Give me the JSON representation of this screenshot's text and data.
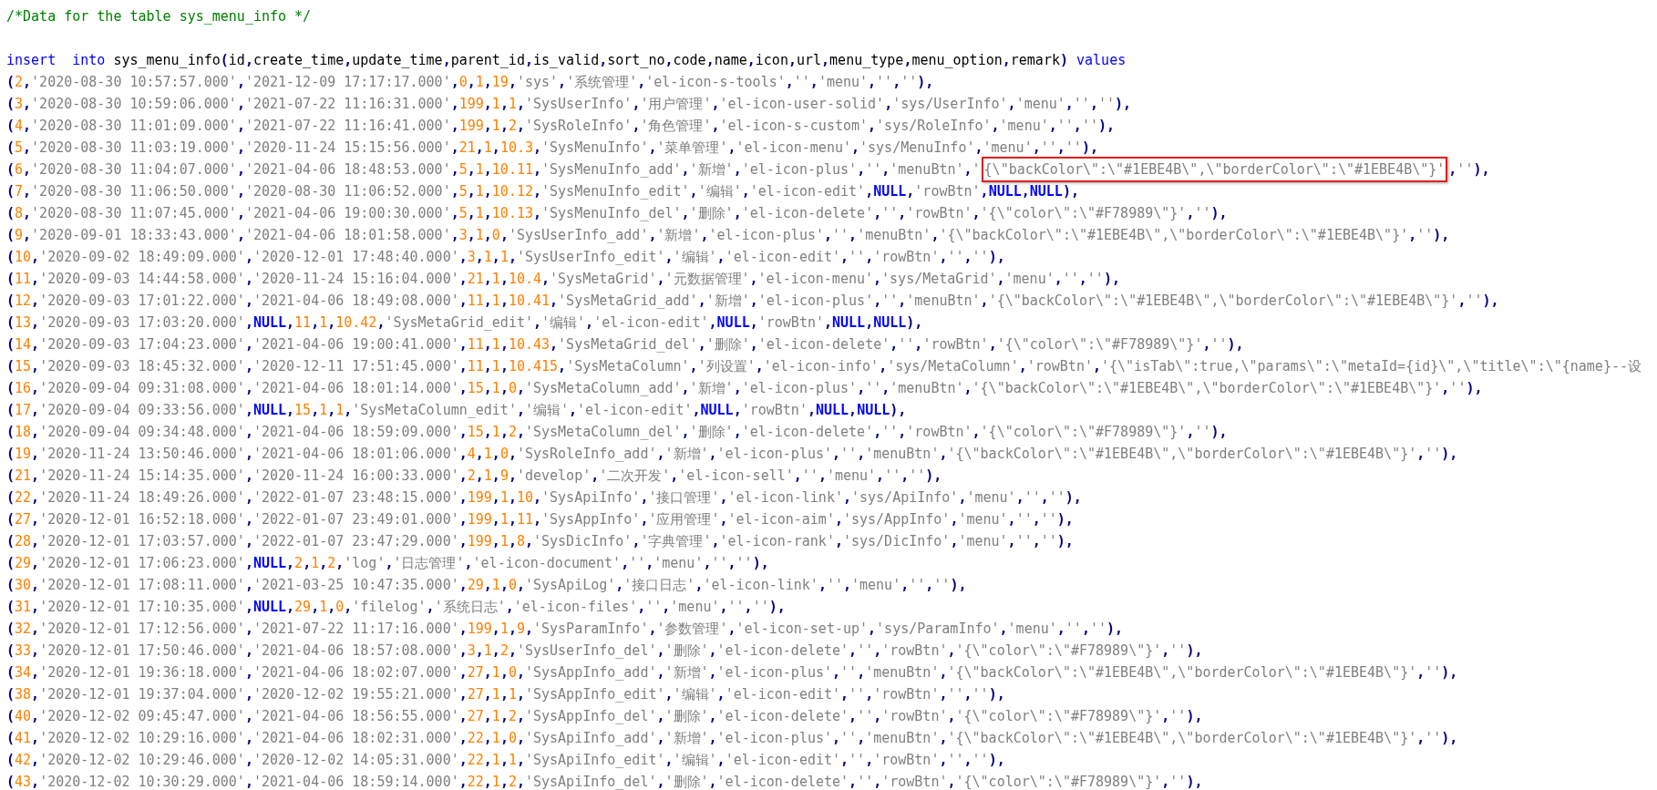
{
  "editor": {
    "lines": [
      {
        "kind": "comment",
        "text": "/*Data for the table sys_menu_info */"
      },
      {
        "kind": "blank"
      },
      {
        "kind": "statement",
        "segments": [
          {
            "kind": "keyword",
            "text": "insert"
          },
          {
            "kind": "keyword",
            "text": "into"
          },
          {
            "kind": "identifier",
            "text": "sys_menu_info(id,create_time,update_time,parent_id,is_valid,sort_no,code,name,icon,url,menu_type,menu_option,remark)"
          },
          {
            "kind": "keyword",
            "text": "values"
          }
        ]
      },
      {
        "kind": "row",
        "text": "(2,'2020-08-30 10:57:57.000','2021-12-09 17:17:17.000',0,1,19,'sys','系统管理','el-icon-s-tools','','menu','',''),"
      },
      {
        "kind": "row",
        "text": "(3,'2020-08-30 10:59:06.000','2021-07-22 11:16:31.000',199,1,1,'SysUserInfo','用户管理','el-icon-user-solid','sys/UserInfo','menu','',''),"
      },
      {
        "kind": "row",
        "text": "(4,'2020-08-30 11:01:09.000','2021-07-22 11:16:41.000',199,1,2,'SysRoleInfo','角色管理','el-icon-s-custom','sys/RoleInfo','menu','',''),"
      },
      {
        "kind": "row",
        "text": "(5,'2020-08-30 11:03:19.000','2020-11-24 15:15:56.000',21,1,10.3,'SysMenuInfo','菜单管理','el-icon-menu','sys/MenuInfo','menu','',''),"
      },
      {
        "kind": "row",
        "segments": [
          {
            "text": "(6,'2020-08-30 11:04:07.000','2021-04-06 18:48:53.000',5,1,10.11,'SysMenuInfo_add','新增','el-icon-plus','','menuBtn','",
            "highlighted": false
          },
          {
            "text": "{\\\"backColor\\\":\\\"#1EBE4B\\\",\\\"borderColor\\\":\\\"#1EBE4B\\\"}'",
            "highlighted": true
          },
          {
            "text": ",''),",
            "highlighted": false
          }
        ]
      },
      {
        "kind": "row",
        "text": "(7,'2020-08-30 11:06:50.000','2020-08-30 11:06:52.000',5,1,10.12,'SysMenuInfo_edit','编辑','el-icon-edit',NULL,'rowBtn',NULL,NULL),"
      },
      {
        "kind": "row",
        "text": "(8,'2020-08-30 11:07:45.000','2021-04-06 19:00:30.000',5,1,10.13,'SysMenuInfo_del','删除','el-icon-delete','','rowBtn','{\\\"color\\\":\\\"#F78989\\\"}',''),"
      },
      {
        "kind": "row",
        "text": "(9,'2020-09-01 18:33:43.000','2021-04-06 18:01:58.000',3,1,0,'SysUserInfo_add','新增','el-icon-plus','','menuBtn','{\\\"backColor\\\":\\\"#1EBE4B\\\",\\\"borderColor\\\":\\\"#1EBE4B\\\"}',''),"
      },
      {
        "kind": "row",
        "text": "(10,'2020-09-02 18:49:09.000','2020-12-01 17:48:40.000',3,1,1,'SysUserInfo_edit','编辑','el-icon-edit','','rowBtn','',''),"
      },
      {
        "kind": "row",
        "text": "(11,'2020-09-03 14:44:58.000','2020-11-24 15:16:04.000',21,1,10.4,'SysMetaGrid','元数据管理','el-icon-menu','sys/MetaGrid','menu','',''),"
      },
      {
        "kind": "row",
        "text": "(12,'2020-09-03 17:01:22.000','2021-04-06 18:49:08.000',11,1,10.41,'SysMetaGrid_add','新增','el-icon-plus','','menuBtn','{\\\"backColor\\\":\\\"#1EBE4B\\\",\\\"borderColor\\\":\\\"#1EBE4B\\\"}',''),"
      },
      {
        "kind": "row",
        "text": "(13,'2020-09-03 17:03:20.000',NULL,11,1,10.42,'SysMetaGrid_edit','编辑','el-icon-edit',NULL,'rowBtn',NULL,NULL),"
      },
      {
        "kind": "row",
        "text": "(14,'2020-09-03 17:04:23.000','2021-04-06 19:00:41.000',11,1,10.43,'SysMetaGrid_del','删除','el-icon-delete','','rowBtn','{\\\"color\\\":\\\"#F78989\\\"}',''),"
      },
      {
        "kind": "row",
        "text": "(15,'2020-09-03 18:45:32.000','2020-12-11 17:51:45.000',11,1,10.415,'SysMetaColumn','列设置','el-icon-info','sys/MetaColumn','rowBtn','{\\\"isTab\\\":true,\\\"params\\\":\\\"metaId={id}\\\",\\\"title\\\":\\\"{name}--设"
      },
      {
        "kind": "row",
        "text": "(16,'2020-09-04 09:31:08.000','2021-04-06 18:01:14.000',15,1,0,'SysMetaColumn_add','新增','el-icon-plus','','menuBtn','{\\\"backColor\\\":\\\"#1EBE4B\\\",\\\"borderColor\\\":\\\"#1EBE4B\\\"}',''),"
      },
      {
        "kind": "row",
        "text": "(17,'2020-09-04 09:33:56.000',NULL,15,1,1,'SysMetaColumn_edit','编辑','el-icon-edit',NULL,'rowBtn',NULL,NULL),"
      },
      {
        "kind": "row",
        "text": "(18,'2020-09-04 09:34:48.000','2021-04-06 18:59:09.000',15,1,2,'SysMetaColumn_del','删除','el-icon-delete','','rowBtn','{\\\"color\\\":\\\"#F78989\\\"}',''),"
      },
      {
        "kind": "row",
        "text": "(19,'2020-11-24 13:50:46.000','2021-04-06 18:01:06.000',4,1,0,'SysRoleInfo_add','新增','el-icon-plus','','menuBtn','{\\\"backColor\\\":\\\"#1EBE4B\\\",\\\"borderColor\\\":\\\"#1EBE4B\\\"}',''),"
      },
      {
        "kind": "row",
        "text": "(21,'2020-11-24 15:14:35.000','2020-11-24 16:00:33.000',2,1,9,'develop','二次开发','el-icon-sell','','menu','',''),"
      },
      {
        "kind": "row",
        "text": "(22,'2020-11-24 18:49:26.000','2022-01-07 23:48:15.000',199,1,10,'SysApiInfo','接口管理','el-icon-link','sys/ApiInfo','menu','',''),"
      },
      {
        "kind": "row",
        "text": "(27,'2020-12-01 16:52:18.000','2022-01-07 23:49:01.000',199,1,11,'SysAppInfo','应用管理','el-icon-aim','sys/AppInfo','menu','',''),"
      },
      {
        "kind": "row",
        "text": "(28,'2020-12-01 17:03:57.000','2022-01-07 23:47:29.000',199,1,8,'SysDicInfo','字典管理','el-icon-rank','sys/DicInfo','menu','',''),"
      },
      {
        "kind": "row",
        "text": "(29,'2020-12-01 17:06:23.000',NULL,2,1,2,'log','日志管理','el-icon-document','','menu','',''),"
      },
      {
        "kind": "row",
        "text": "(30,'2020-12-01 17:08:11.000','2021-03-25 10:47:35.000',29,1,0,'SysApiLog','接口日志','el-icon-link','','menu','',''),"
      },
      {
        "kind": "row",
        "text": "(31,'2020-12-01 17:10:35.000',NULL,29,1,0,'filelog','系统日志','el-icon-files','','menu','',''),"
      },
      {
        "kind": "row",
        "text": "(32,'2020-12-01 17:12:56.000','2021-07-22 11:17:16.000',199,1,9,'SysParamInfo','参数管理','el-icon-set-up','sys/ParamInfo','menu','',''),"
      },
      {
        "kind": "row",
        "text": "(33,'2020-12-01 17:50:46.000','2021-04-06 18:57:08.000',3,1,2,'SysUserInfo_del','删除','el-icon-delete','','rowBtn','{\\\"color\\\":\\\"#F78989\\\"}',''),"
      },
      {
        "kind": "row",
        "text": "(34,'2020-12-01 19:36:18.000','2021-04-06 18:02:07.000',27,1,0,'SysAppInfo_add','新增','el-icon-plus','','menuBtn','{\\\"backColor\\\":\\\"#1EBE4B\\\",\\\"borderColor\\\":\\\"#1EBE4B\\\"}',''),"
      },
      {
        "kind": "row",
        "text": "(38,'2020-12-01 19:37:04.000','2020-12-02 19:55:21.000',27,1,1,'SysAppInfo_edit','编辑','el-icon-edit','','rowBtn','',''),"
      },
      {
        "kind": "row",
        "text": "(40,'2020-12-02 09:45:47.000','2021-04-06 18:56:55.000',27,1,2,'SysAppInfo_del','删除','el-icon-delete','','rowBtn','{\\\"color\\\":\\\"#F78989\\\"}',''),"
      },
      {
        "kind": "row",
        "text": "(41,'2020-12-02 10:29:16.000','2021-04-06 18:02:31.000',22,1,0,'SysApiInfo_add','新增','el-icon-plus','','menuBtn','{\\\"backColor\\\":\\\"#1EBE4B\\\",\\\"borderColor\\\":\\\"#1EBE4B\\\"}',''),"
      },
      {
        "kind": "row",
        "text": "(42,'2020-12-02 10:29:46.000','2020-12-02 14:05:31.000',22,1,1,'SysApiInfo_edit','编辑','el-icon-edit','','rowBtn','',''),"
      },
      {
        "kind": "row",
        "text": "(43,'2020-12-02 10:30:29.000','2021-04-06 18:59:14.000',22,1,2,'SysApiInfo_del','删除','el-icon-delete','','rowBtn','{\\\"color\\\":\\\"#F78989\\\"}',''),"
      }
    ]
  }
}
